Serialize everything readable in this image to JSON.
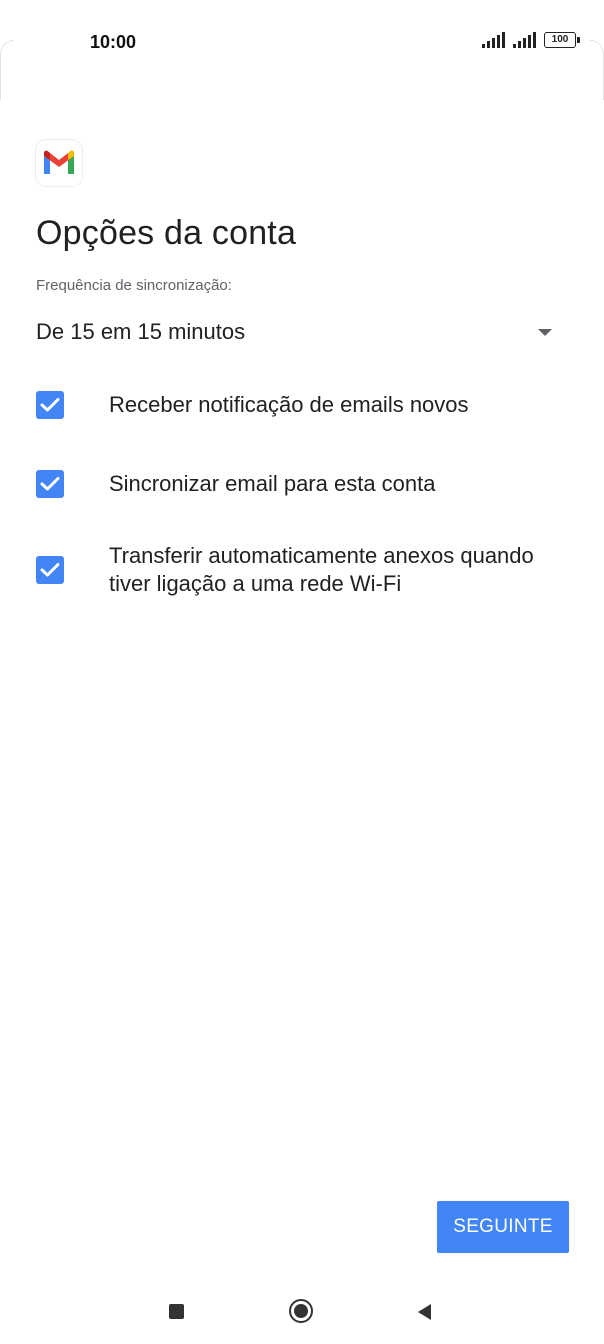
{
  "status_bar": {
    "time": "10:00",
    "battery": "100",
    "icons": [
      "signal-icon",
      "signal-icon",
      "battery-icon"
    ]
  },
  "app": {
    "logo_icon": "gmail-icon",
    "colors": {
      "accent": "#4285f4"
    }
  },
  "page": {
    "title": "Opções da conta",
    "frequency_label": "Frequência de sincronização:",
    "frequency_value": "De 15 em 15 minutos"
  },
  "options": [
    {
      "label": "Receber notificação de emails novos",
      "checked": true
    },
    {
      "label": "Sincronizar email para esta conta",
      "checked": true
    },
    {
      "label": "Transferir automaticamente anexos quando tiver ligação a uma rede Wi-Fi",
      "checked": true
    }
  ],
  "actions": {
    "next_label": "SEGUINTE"
  },
  "navbar": {
    "icons": [
      "recents-icon",
      "home-icon",
      "back-icon"
    ]
  }
}
